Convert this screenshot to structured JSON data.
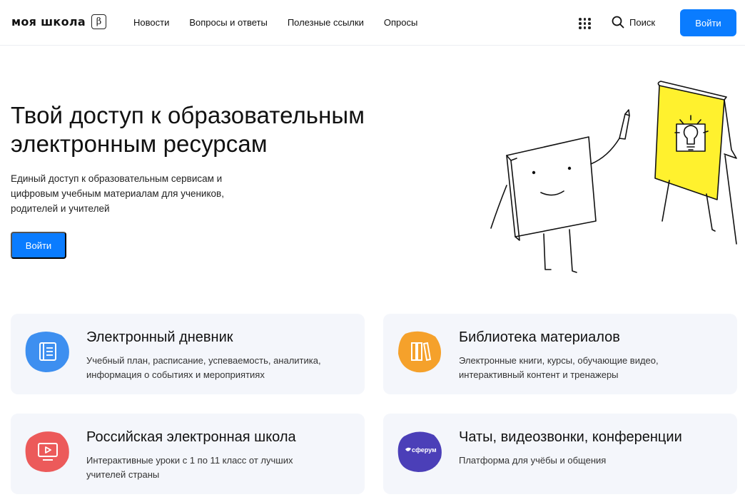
{
  "header": {
    "logo": "моя школа",
    "beta": "β",
    "nav": [
      "Новости",
      "Вопросы и ответы",
      "Полезные ссылки",
      "Опросы"
    ],
    "search_label": "Поиск",
    "login_label": "Войти"
  },
  "hero": {
    "title": "Твой доступ к образовательным\nэлектронным ресурсам",
    "subtitle": "Единый доступ к образовательным сервисам и\nцифровым учебным материалам для учеников,\nродителей и учителей",
    "login_label": "Войти"
  },
  "cards": [
    {
      "title": "Электронный дневник",
      "description": "Учебный план, расписание, успеваемость, аналитика,\nинформация о событиях и мероприятиях",
      "icon": "diary-icon",
      "color": "#3d8ff0"
    },
    {
      "title": "Библиотека материалов",
      "description": "Электронные книги, курсы, обучающие видео,\nинтерактивный контент и тренажеры",
      "icon": "books-icon",
      "color": "#f5a12b"
    },
    {
      "title": "Российская электронная школа",
      "description": "Интерактивные уроки с 1 по 11 класс от лучших\nучителей страны",
      "icon": "video-icon",
      "color": "#ec5a5a"
    },
    {
      "title": "Чаты, видеозвонки, конференции",
      "description": "Платформа для учёбы и общения",
      "icon": "sferum-icon",
      "icon_text": "сферум",
      "color": "#4b3fb8"
    }
  ]
}
